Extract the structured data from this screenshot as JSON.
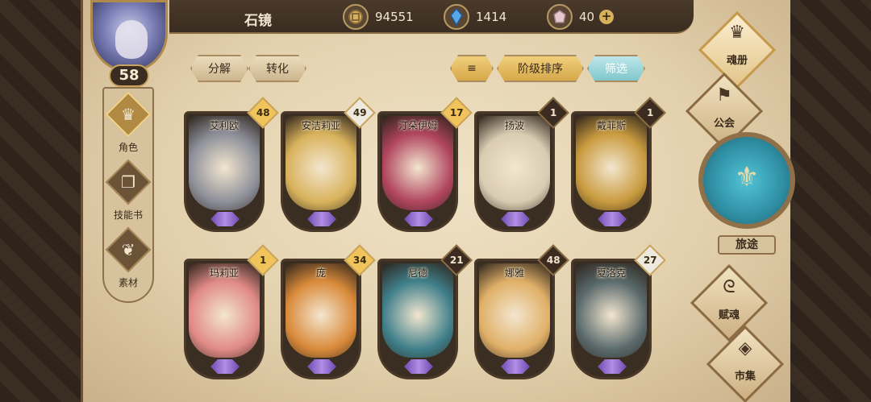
{
  "player": {
    "name": "石镜",
    "level": "58"
  },
  "resources": {
    "gold": "94551",
    "crystal": "1414",
    "gem": "40",
    "gem_plus": "+"
  },
  "left_nav": [
    {
      "label": "角色",
      "icon": "horned-helmet-icon",
      "glyph": "♛"
    },
    {
      "label": "技能书",
      "icon": "book-icon",
      "glyph": "❐"
    },
    {
      "label": "素材",
      "icon": "material-icon",
      "glyph": "❦"
    }
  ],
  "actions": {
    "decompose": "分解",
    "convert": "转化",
    "sort_icon": "≡",
    "sort_rank": "阶级排序",
    "filter": "筛选"
  },
  "heroes": [
    {
      "name": "艾利欧",
      "level": "48",
      "badge": "gold",
      "color": "#8d8f99"
    },
    {
      "name": "安洁莉亚",
      "level": "49",
      "badge": "white",
      "color": "#d8b25c"
    },
    {
      "name": "汀朵伊姆",
      "level": "17",
      "badge": "gold",
      "color": "#b0455e"
    },
    {
      "name": "扬波",
      "level": "1",
      "badge": "dark",
      "color": "#d9ccb2"
    },
    {
      "name": "戴菲斯",
      "level": "1",
      "badge": "dark",
      "color": "#c99b3f"
    },
    {
      "name": "玛莉亚",
      "level": "1",
      "badge": "gold",
      "color": "#e08a86"
    },
    {
      "name": "庞",
      "level": "34",
      "badge": "gold",
      "color": "#d98a3a"
    },
    {
      "name": "尼德",
      "level": "21",
      "badge": "dark",
      "color": "#3f7f8a"
    },
    {
      "name": "娜雅",
      "level": "48",
      "badge": "dark",
      "color": "#e0b068"
    },
    {
      "name": "夏洛克",
      "level": "27",
      "badge": "white",
      "color": "#5a6a6c"
    }
  ],
  "right_menu": {
    "soul_book": "魂册",
    "guild": "公会",
    "journey": "旅途",
    "soul_gift": "赋魂",
    "market": "市集"
  }
}
